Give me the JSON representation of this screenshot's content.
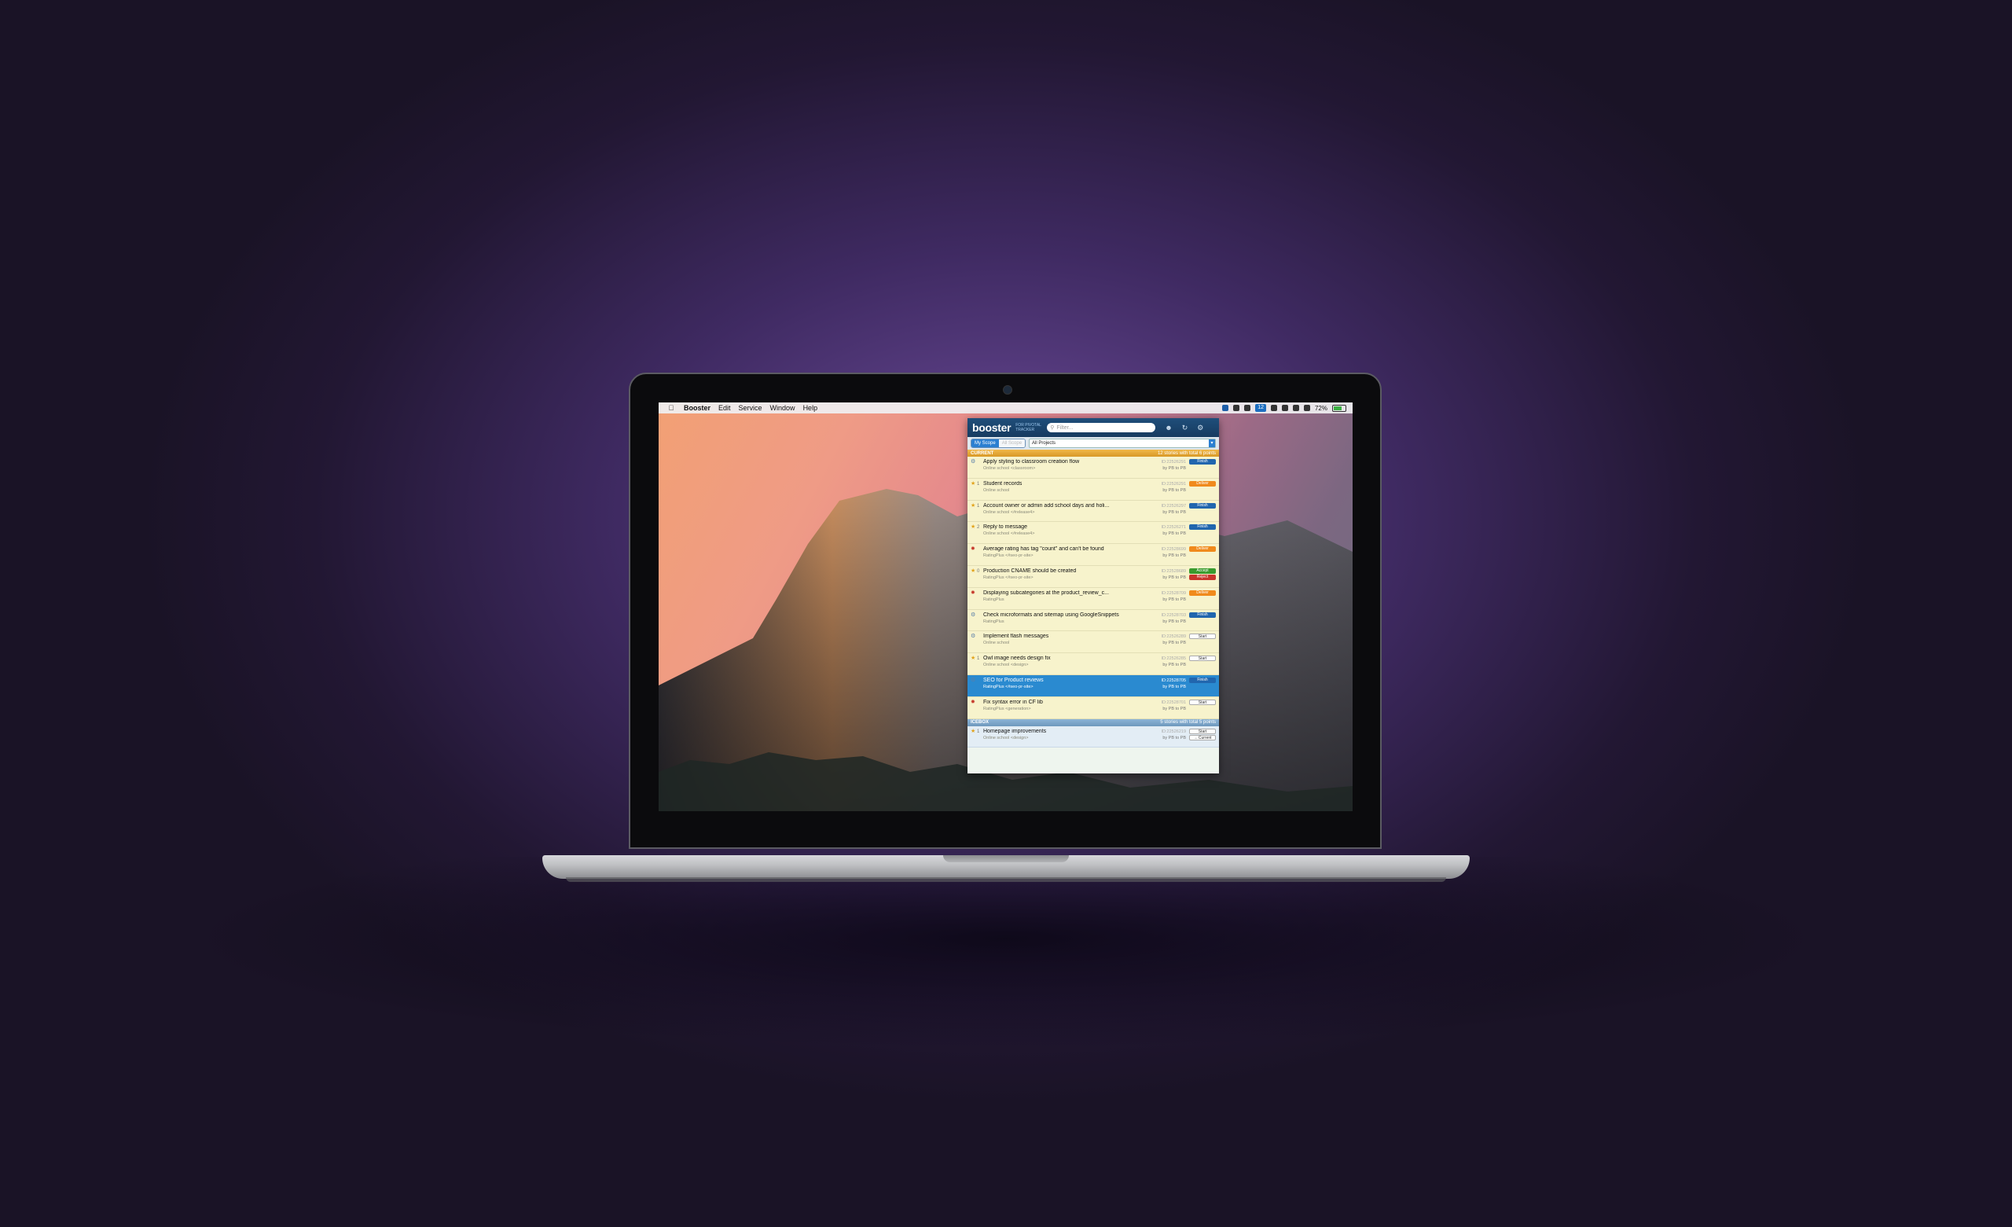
{
  "menubar": {
    "apple_glyph": "",
    "items": [
      "Booster",
      "Edit",
      "Service",
      "Window",
      "Help"
    ],
    "tray_badge": "12",
    "battery_text": "72%",
    "battery_level": 0.72
  },
  "booster": {
    "logo": "booster",
    "logo_subtitle": "FOR PIVOTAL TRACKER",
    "filter_placeholder": "Filter...",
    "scope_on": "My Scope",
    "scope_off": "All Scope",
    "project_select": "All Projects",
    "current_section": {
      "label": "CURRENT",
      "summary": "12 stories with total 6 points"
    },
    "icebox_section": {
      "label": "ICEBOX",
      "summary": "5 stories with total 5 points"
    },
    "stories": [
      {
        "type_icon": "⚙",
        "points": "",
        "title": "Apply styling to classroom creation flow",
        "project": "Online school <classroom>",
        "id": "ID:22526291",
        "by": "by PB to PB",
        "actions": [
          "Finish"
        ]
      },
      {
        "type_icon": "★",
        "points": "1",
        "title": "Student records",
        "project": "Online school",
        "id": "ID:22526291",
        "by": "by PB to PB",
        "actions": [
          "Deliver"
        ]
      },
      {
        "type_icon": "★",
        "points": "1",
        "title": "Account owner or admin add school days and holi...",
        "project": "Online school <#release4>",
        "id": "ID:22526297",
        "by": "by PB to PB",
        "actions": [
          "Finish"
        ]
      },
      {
        "type_icon": "★",
        "points": "2",
        "title": "Reply to message",
        "project": "Online school <#release4>",
        "id": "ID:22526271",
        "by": "by PB to PB",
        "actions": [
          "Finish"
        ]
      },
      {
        "type_icon": "✹",
        "points": "",
        "title": "Average rating has tag \"count\" and can't be found",
        "project": "RatingPlus <#seo-pr-site>",
        "id": "ID:22528699",
        "by": "by PB to PB",
        "actions": [
          "Deliver"
        ]
      },
      {
        "type_icon": "★",
        "points": "0",
        "title": "Production CNAME should be created",
        "project": "RatingPlus <#seo-pr-site>",
        "id": "ID:22528689",
        "by": "by PB to PB",
        "actions": [
          "Accept",
          "Reject"
        ]
      },
      {
        "type_icon": "✹",
        "points": "",
        "title": "Displaying subcategories at the product_review_c...",
        "project": "RatingPlus",
        "id": "ID:22528709",
        "by": "by PB to PB",
        "actions": [
          "Deliver"
        ]
      },
      {
        "type_icon": "⚙",
        "points": "",
        "title": "Check microformats and sitemap using GoogleSnippets",
        "project": "RatingPlus",
        "id": "ID:22528703",
        "by": "by PB to PB",
        "actions": [
          "Finish"
        ]
      },
      {
        "type_icon": "⚙",
        "points": "",
        "title": "Implement flash messages",
        "project": "Online school",
        "id": "ID:22526289",
        "by": "by PB to PB",
        "actions": [
          "Start"
        ]
      },
      {
        "type_icon": "★",
        "points": "1",
        "title": "Owl image needs design fix",
        "project": "Online school <design>",
        "id": "ID:22526285",
        "by": "by PB to PB",
        "actions": [
          "Start"
        ]
      },
      {
        "type_icon": "⚙",
        "points": "",
        "title": "SEO for Product reviews",
        "project": "RatingPlus <#seo-pr-site>",
        "id": "ID:22528705",
        "by": "by PB to PB",
        "actions": [
          "Finish"
        ],
        "selected": true
      },
      {
        "type_icon": "✹",
        "points": "",
        "title": "Fix syntax error in CF lib",
        "project": "RatingPlus <generation>",
        "id": "ID:22528701",
        "by": "by PB to PB",
        "actions": [
          "Start"
        ]
      }
    ],
    "icebox_stories": [
      {
        "type_icon": "★",
        "points": "1",
        "title": "Homepage improvements",
        "project": "Online school <design>",
        "id": "ID:22526219",
        "by": "by PB to PB",
        "actions": [
          "Start",
          "→ Current"
        ]
      }
    ]
  }
}
